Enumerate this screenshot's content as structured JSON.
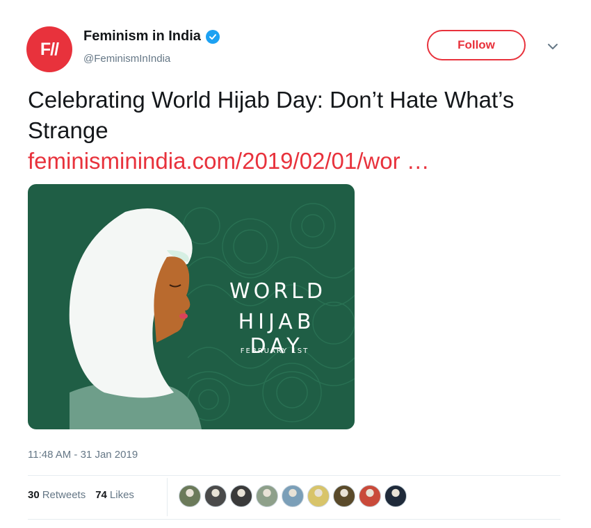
{
  "account": {
    "avatar_text": "F//",
    "display_name": "Feminism in India",
    "handle": "@FeminismInIndia",
    "verified": true,
    "follow_label": "Follow"
  },
  "tweet": {
    "text": "Celebrating World Hijab Day: Don’t Hate What’s Strange",
    "link": "feminisminindia.com/2019/02/01/wor …",
    "timestamp": "11:48 AM - 31 Jan 2019"
  },
  "media": {
    "line1": "WORLD",
    "line2": "HIJAB DAY",
    "line3": "FEBRUARY 1ST"
  },
  "stats": {
    "retweets_count": "30",
    "retweets_label": "Retweets",
    "likes_count": "74",
    "likes_label": "Likes"
  },
  "likers": [
    {
      "color": "#6b7a5a"
    },
    {
      "color": "#4a4a4a"
    },
    {
      "color": "#3a3a3a"
    },
    {
      "color": "#8ea08a"
    },
    {
      "color": "#7b9fb8"
    },
    {
      "color": "#d8c46a"
    },
    {
      "color": "#5a4a2a"
    },
    {
      "color": "#c94a3a"
    },
    {
      "color": "#1f2a3a"
    }
  ],
  "colors": {
    "brand": "#e8323c",
    "verified": "#1da1f2",
    "muted": "#657786",
    "media_bg": "#1f5e45"
  }
}
